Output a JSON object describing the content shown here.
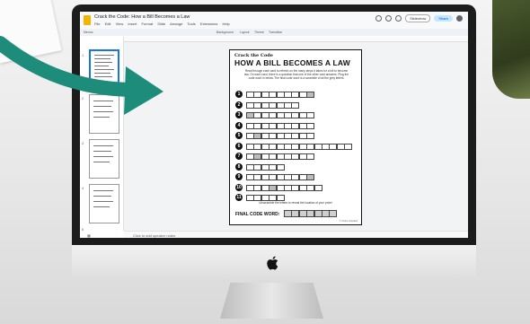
{
  "app": {
    "doc_title": "Crack the Code: How a Bill Becomes a Law",
    "menu": [
      "File",
      "Edit",
      "View",
      "Insert",
      "Format",
      "Slide",
      "Arrange",
      "Tools",
      "Extensions",
      "Help"
    ],
    "toolbar": {
      "menus_label": "Menus",
      "background": "Background",
      "layout": "Layout",
      "theme": "Theme",
      "transition": "Transition"
    },
    "slideshow_label": "Slideshow",
    "share_label": "Share",
    "speaker_notes_placeholder": "Click to add speaker notes"
  },
  "filmstrip": {
    "slide_numbers": [
      "1",
      "2",
      "3",
      "4",
      "5"
    ]
  },
  "worksheet": {
    "brand": "Crack the Code",
    "title": "HOW A BILL BECOMES A LAW",
    "instructions": "Read through each card to refresh on the many steps it takes for a bill to become law. On each card, there is a question that one of the other card answers. Plug the code word in below. The final code word is a scramble of all the grey letters.",
    "rows": [
      {
        "num": "1",
        "boxes": 9,
        "grey": [
          8
        ]
      },
      {
        "num": "2",
        "boxes": 7,
        "grey": []
      },
      {
        "num": "3",
        "boxes": 9,
        "grey": [
          0
        ]
      },
      {
        "num": "4",
        "boxes": 9,
        "grey": []
      },
      {
        "num": "5",
        "boxes": 9,
        "grey": [
          1
        ]
      },
      {
        "num": "6",
        "boxes": 14,
        "grey": []
      },
      {
        "num": "7",
        "boxes": 9,
        "grey": [
          1
        ]
      },
      {
        "num": "8",
        "boxes": 5,
        "grey": []
      },
      {
        "num": "9",
        "boxes": 9,
        "grey": [
          8
        ]
      },
      {
        "num": "10",
        "boxes": 10,
        "grey": [
          3
        ]
      },
      {
        "num": "11",
        "boxes": 5,
        "grey": []
      }
    ],
    "unscramble": "Unscramble the letters to reveal the location of your prize!",
    "final_label": "FINAL CODE WORD:",
    "final_boxes": 7,
    "credit": "© Civics Unlocked"
  },
  "colors": {
    "arrow": "#1e8c7a",
    "share_bg": "#c2e7ff",
    "accent": "#1a73e8"
  }
}
